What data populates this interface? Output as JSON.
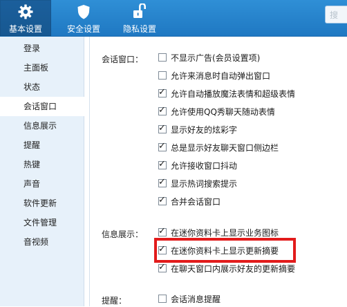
{
  "tabs": [
    {
      "label": "基本设置",
      "icon": "gear-icon",
      "active": true
    },
    {
      "label": "安全设置",
      "icon": "shield-icon",
      "active": false
    },
    {
      "label": "隐私设置",
      "icon": "unlock-icon",
      "active": false
    }
  ],
  "search": {
    "placeholder": "搜"
  },
  "sidebar": {
    "items": [
      {
        "label": "登录"
      },
      {
        "label": "主面板"
      },
      {
        "label": "状态"
      },
      {
        "label": "会话窗口"
      },
      {
        "label": "信息展示"
      },
      {
        "label": "提醒"
      },
      {
        "label": "热键"
      },
      {
        "label": "声音"
      },
      {
        "label": "软件更新"
      },
      {
        "label": "文件管理"
      },
      {
        "label": "音视频"
      }
    ],
    "active_index": 3
  },
  "sections": {
    "session": {
      "label": "会话窗口：",
      "options": [
        {
          "label": "不显示广告(会员设置项)",
          "checked": false
        },
        {
          "label": "允许来消息时自动弹出窗口",
          "checked": false
        },
        {
          "label": "允许自动播放魔法表情和超级表情",
          "checked": true
        },
        {
          "label": "允许使用QQ秀聊天随动表情",
          "checked": true
        },
        {
          "label": "显示好友的炫彩字",
          "checked": true
        },
        {
          "label": "总是显示好友聊天窗口侧边栏",
          "checked": true
        },
        {
          "label": "允许接收窗口抖动",
          "checked": true
        },
        {
          "label": "显示热词搜索提示",
          "checked": true
        },
        {
          "label": "合并会话窗口",
          "checked": true
        }
      ]
    },
    "info": {
      "label": "信息展示：",
      "options": [
        {
          "label": "在迷你资料卡上显示业务图标",
          "checked": true
        },
        {
          "label": "在迷你资料卡上显示更新摘要",
          "checked": true
        },
        {
          "label": "在聊天窗口内展示好友的更新摘要",
          "checked": true
        }
      ]
    },
    "remind": {
      "label": "提醒：",
      "options": [
        {
          "label": "会话消息提醒",
          "checked": false
        }
      ]
    }
  },
  "colors": {
    "topbar": "#2383cc",
    "highlight": "#e21b1b",
    "sidebar_bg": "#e7f1fa"
  }
}
